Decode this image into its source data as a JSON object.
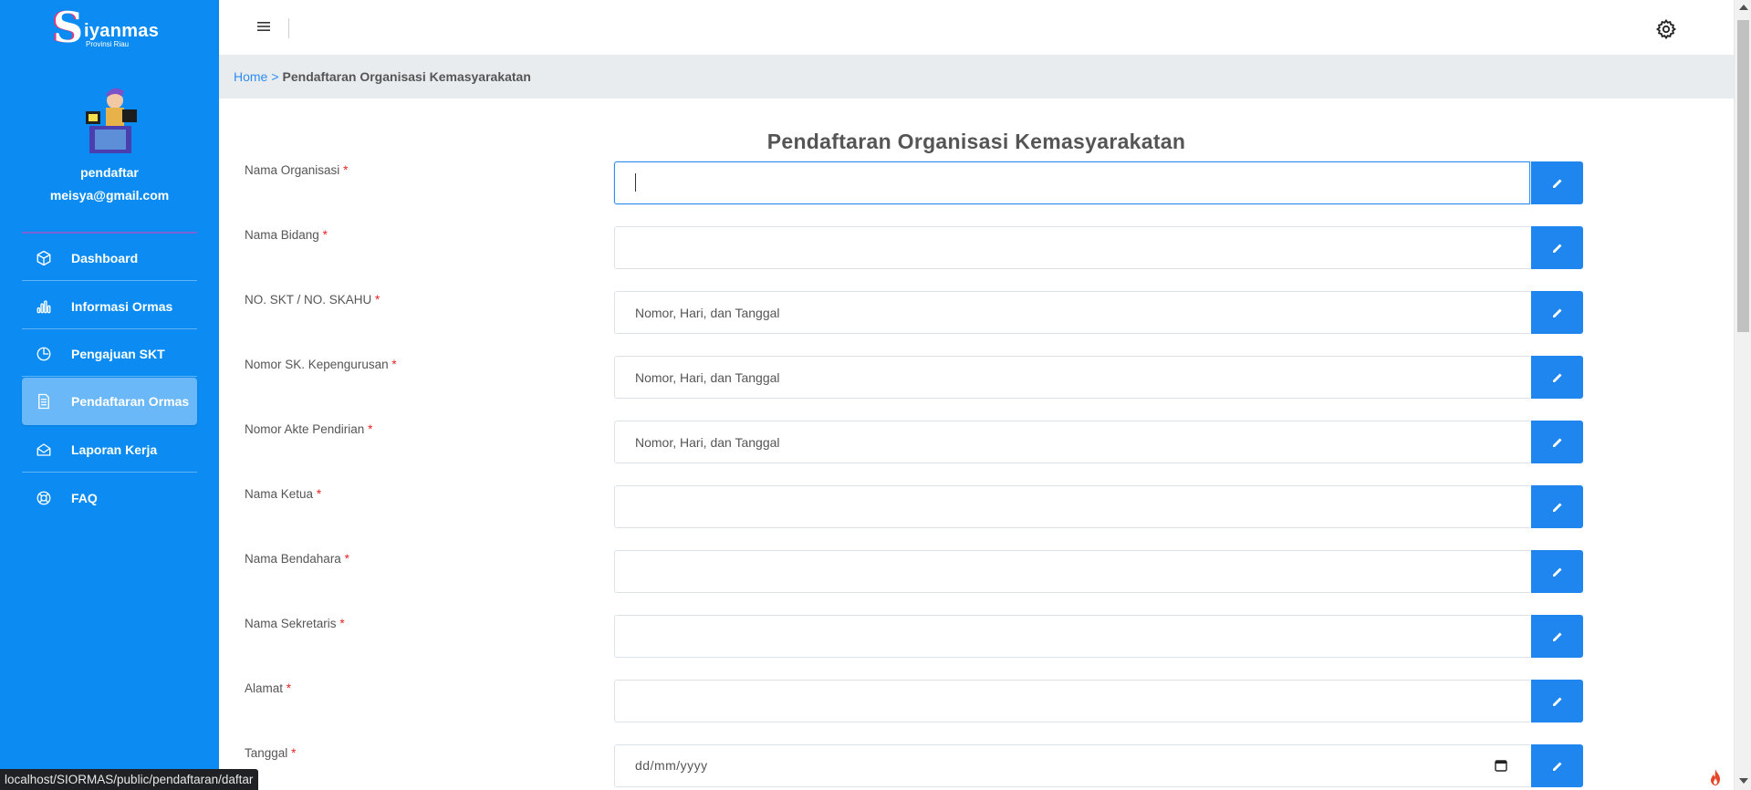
{
  "brand": {
    "name": "iyanmas",
    "letter": "S",
    "subtitle": "Provinsi Riau"
  },
  "user": {
    "name": "pendaftar",
    "email": "meisya@gmail.com"
  },
  "sidebar": {
    "items": [
      {
        "label": "Dashboard",
        "icon": "box-icon",
        "active": false
      },
      {
        "label": "Informasi Ormas",
        "icon": "bar-chart-icon",
        "active": false
      },
      {
        "label": "Pengajuan SKT",
        "icon": "clock-icon",
        "active": false
      },
      {
        "label": "Pendaftaran Ormas",
        "icon": "document-icon",
        "active": true
      },
      {
        "label": "Laporan Kerja",
        "icon": "mail-icon",
        "active": false
      },
      {
        "label": "FAQ",
        "icon": "lifebuoy-icon",
        "active": false
      }
    ]
  },
  "breadcrumb": {
    "home": "Home",
    "separator": ">",
    "current": "Pendaftaran Organisasi Kemasyarakatan"
  },
  "form": {
    "title": "Pendaftaran Organisasi Kemasyarakatan",
    "required_mark": "*",
    "fields": [
      {
        "label": "Nama Organisasi",
        "value": "",
        "placeholder": ""
      },
      {
        "label": "Nama Bidang",
        "value": "",
        "placeholder": ""
      },
      {
        "label": "NO. SKT / NO. SKAHU",
        "value": "",
        "placeholder": "Nomor, Hari, dan Tanggal"
      },
      {
        "label": "Nomor SK. Kepengurusan",
        "value": "",
        "placeholder": "Nomor, Hari, dan Tanggal"
      },
      {
        "label": "Nomor Akte Pendirian",
        "value": "",
        "placeholder": "Nomor, Hari, dan Tanggal"
      },
      {
        "label": "Nama Ketua",
        "value": "",
        "placeholder": ""
      },
      {
        "label": "Nama Bendahara",
        "value": "",
        "placeholder": ""
      },
      {
        "label": "Nama Sekretaris",
        "value": "",
        "placeholder": ""
      },
      {
        "label": "Alamat",
        "value": "",
        "placeholder": ""
      },
      {
        "label": "Tanggal",
        "value": "dd/mm/yyyy",
        "placeholder": ""
      }
    ]
  },
  "status_bar": {
    "url": "localhost/SIORMAS/public/pendaftaran/daftar"
  },
  "colors": {
    "sidebar": "#0c8cf2",
    "accent": "#1f86ef",
    "required": "#e52424",
    "active_item": "#6ab8f7"
  }
}
